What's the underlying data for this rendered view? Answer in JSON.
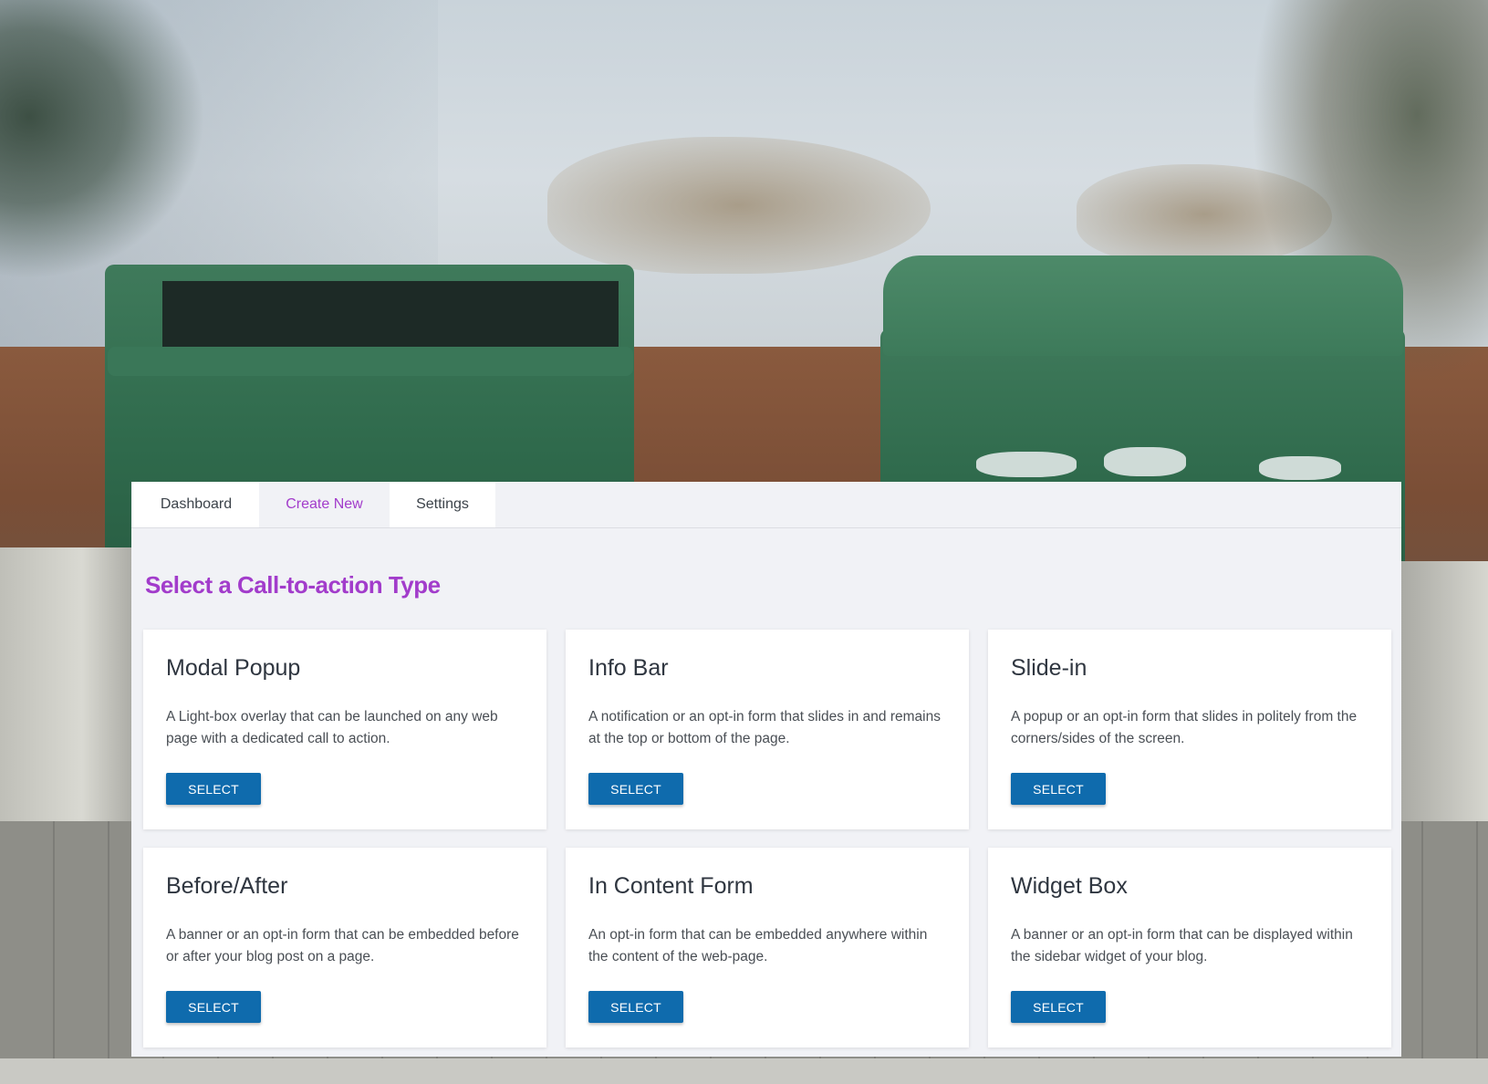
{
  "tabs": [
    {
      "label": "Dashboard"
    },
    {
      "label": "Create New"
    },
    {
      "label": "Settings"
    }
  ],
  "page_heading": "Select a Call-to-action Type",
  "cards": [
    {
      "title": "Modal Popup",
      "description": "A Light-box overlay that can be launched on any web page with a dedicated call to action.",
      "button": "SELECT"
    },
    {
      "title": "Info Bar",
      "description": "A notification or an opt-in form that slides in and remains at the top or bottom of the page.",
      "button": "SELECT"
    },
    {
      "title": "Slide-in",
      "description": "A popup or an opt-in form that slides in politely from the corners/sides of the screen.",
      "button": "SELECT"
    },
    {
      "title": "Before/After",
      "description": "A banner or an opt-in form that can be embedded before or after your blog post on a page.",
      "button": "SELECT"
    },
    {
      "title": "In Content Form",
      "description": "An opt-in form that can be embedded anywhere within the content of the web-page.",
      "button": "SELECT"
    },
    {
      "title": "Widget Box",
      "description": "A banner or an opt-in form that can be displayed within the sidebar widget of your blog.",
      "button": "SELECT"
    }
  ],
  "colors": {
    "accent_purple": "#a23ccb",
    "button_blue": "#0f6bad",
    "panel_bg": "#f1f2f6"
  }
}
